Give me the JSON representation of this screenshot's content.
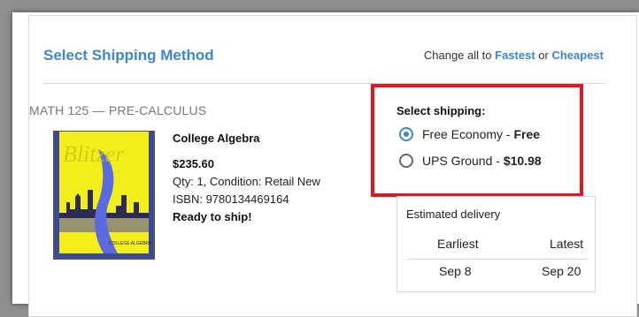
{
  "header": {
    "title": "Select Shipping Method",
    "change_prefix": "Change all to",
    "fastest": "Fastest",
    "or": "or",
    "cheapest": "Cheapest"
  },
  "item": {
    "course": "MATH 125 — PRE-CALCULUS",
    "title": "College Algebra",
    "price": "$235.60",
    "qty_condition": "Qty: 1, Condition: Retail New",
    "isbn": "ISBN: 9780134469164",
    "status": "Ready to ship!",
    "cover": {
      "author": "Blitzer",
      "subject": "COLLEGE ALGEBRA"
    }
  },
  "shipping": {
    "label": "Select shipping:",
    "options": [
      {
        "name": "Free Economy",
        "sep": " - ",
        "price": "Free",
        "selected": true
      },
      {
        "name": "UPS Ground",
        "sep": " - ",
        "price": "$10.98",
        "selected": false
      }
    ],
    "highlight_color": "#e8141e"
  },
  "delivery": {
    "title": "Estimated delivery",
    "columns": [
      "Earliest",
      "Latest"
    ],
    "values": [
      "Sep 8",
      "Sep 20"
    ]
  },
  "colors": {
    "accent": "#3b86d6"
  }
}
